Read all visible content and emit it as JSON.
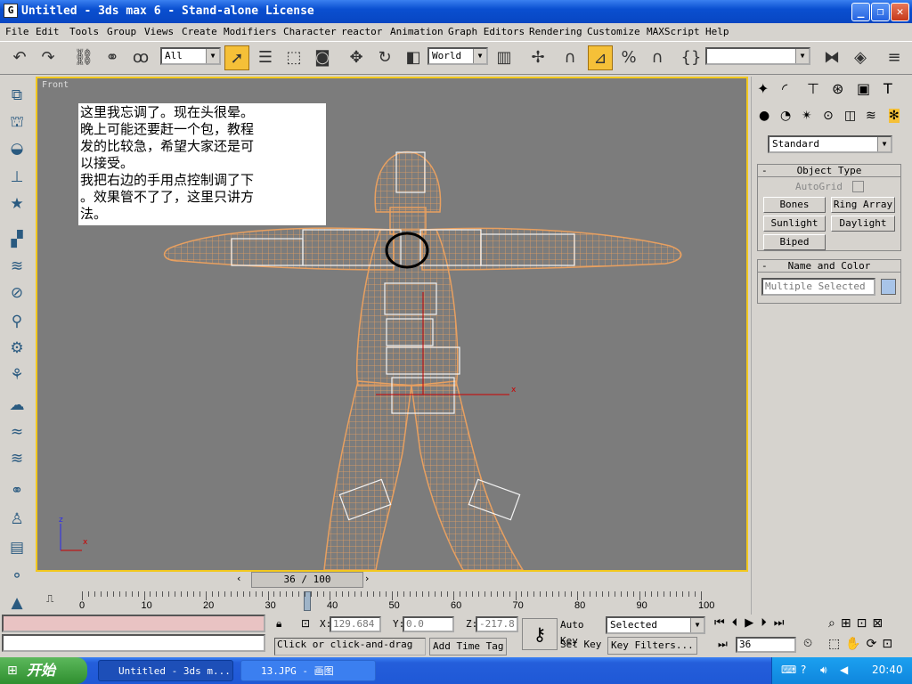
{
  "window": {
    "title": "Untitled - 3ds max 6 - Stand-alone License",
    "icon": "3ds-max-icon"
  },
  "menu": [
    "File",
    "Edit",
    "Tools",
    "Group",
    "Views",
    "Create",
    "Modifiers",
    "Character",
    "reactor",
    "Animation",
    "Graph Editors",
    "Rendering",
    "Customize",
    "MAXScript",
    "Help"
  ],
  "toolbar": {
    "selection_filter": "All",
    "reference_coord": "World",
    "named_selection": ""
  },
  "viewport": {
    "label": "Front",
    "note": "这里我忘调了。现在头很晕。\n晚上可能还要赶一个包，教程\n发的比较急，希望大家还是可\n以接受。\n我把右边的手用点控制调了下\n。效果管不了了，这里只讲方\n法。",
    "axis_x": "x",
    "axis_z": "z"
  },
  "command_panel": {
    "category": "Standard",
    "object_type": {
      "title": "Object Type",
      "autogrid": "AutoGrid",
      "buttons": [
        "Bones",
        "Ring Array",
        "Sunlight",
        "Daylight",
        "Biped"
      ]
    },
    "name_color": {
      "title": "Name and Color",
      "name_value": "Multiple Selected",
      "swatch": "#a8c4e8"
    }
  },
  "timeline": {
    "frame": "36 / 100",
    "ticks": [
      "0",
      "10",
      "20",
      "30",
      "40",
      "50",
      "60",
      "70",
      "80",
      "90",
      "100"
    ]
  },
  "status": {
    "x_label": "X:",
    "x_value": "129.684",
    "y_label": "Y:",
    "y_value": "0.0",
    "z_label": "Z:",
    "z_value": "-217.8",
    "prompt": "Click or click-and-drag",
    "add_time_tag": "Add Time Tag",
    "auto_key": "Auto Key",
    "set_key": "Set Key",
    "key_mode": "Selected",
    "key_filters": "Key Filters...",
    "current_frame": "36"
  },
  "taskbar": {
    "start": "开始",
    "tasks": [
      "Untitled - 3ds m...",
      "13.JPG - 画图"
    ],
    "clock": "20:40"
  },
  "colors": {
    "viewport_bg": "#7c7c7c",
    "active_border": "#f2c81e",
    "mesh": "#e8a060"
  }
}
